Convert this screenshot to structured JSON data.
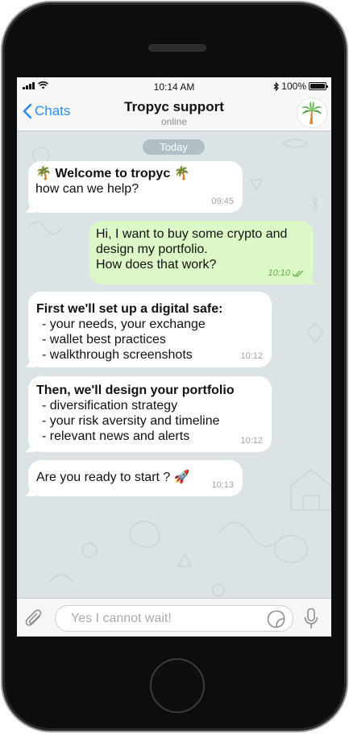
{
  "status_bar": {
    "time": "10:14 AM",
    "battery": "100%",
    "signal_icon": "signal-bars-icon",
    "wifi_icon": "wifi-icon",
    "bluetooth_icon": "bluetooth-icon",
    "battery_icon": "battery-icon"
  },
  "nav": {
    "back_label": "Chats",
    "title": "Tropyc support",
    "subtitle": "online",
    "avatar_icon": "palm-tree-icon"
  },
  "chat": {
    "date_label": "Today",
    "messages": [
      {
        "direction": "in",
        "lines": [
          "🌴 Welcome to tropyc 🌴",
          "how can we help?"
        ],
        "time": "09:45"
      },
      {
        "direction": "out",
        "lines": [
          "Hi, I want to buy some crypto and",
          "design my portfolio.",
          "How does that work?"
        ],
        "time": "10:10",
        "status_icon": "double-check-icon"
      },
      {
        "direction": "in",
        "title": "First we'll set up a digital safe:",
        "lines": [
          "- your needs, your exchange",
          "- wallet best practices",
          "- walkthrough screenshots"
        ],
        "time": "10:12"
      },
      {
        "direction": "in",
        "title": "Then, we'll design your portfolio",
        "lines": [
          "- diversification strategy",
          "- your risk aversity and timeline",
          "- relevant news and alerts"
        ],
        "time": "10:12"
      },
      {
        "direction": "in",
        "lines": [
          "Are you ready to start ? 🚀"
        ],
        "time": "10:13"
      }
    ]
  },
  "input_bar": {
    "placeholder": "Yes I cannot wait!",
    "attach_icon": "paperclip-icon",
    "sticker_icon": "sticker-icon",
    "mic_icon": "microphone-icon"
  },
  "colors": {
    "accent": "#2e8ce8",
    "outgoing_bubble": "#dcf8c6",
    "incoming_bubble": "#ffffff",
    "chat_background": "#dce3e6"
  }
}
